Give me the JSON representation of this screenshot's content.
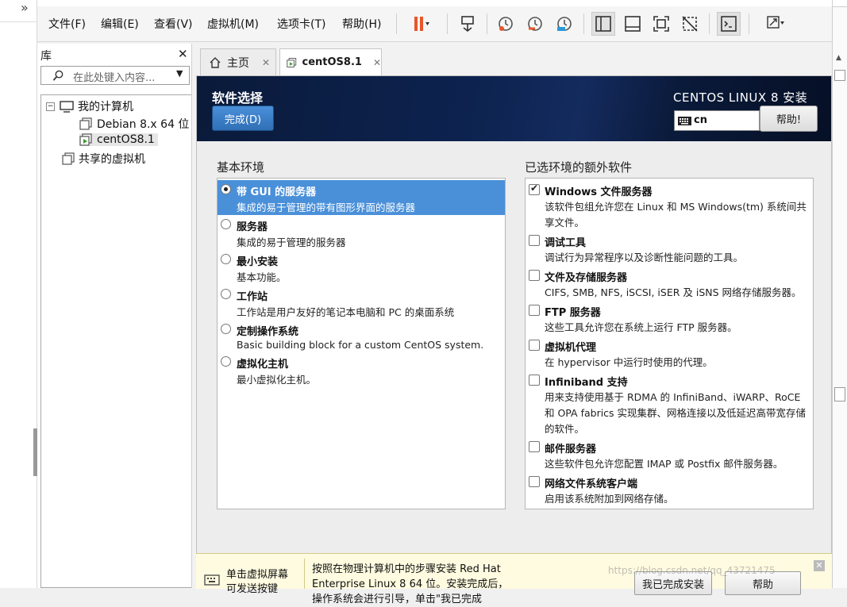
{
  "outer": {
    "chevron": "»"
  },
  "menubar": {
    "items": [
      "文件(F)",
      "编辑(E)",
      "查看(V)",
      "虚拟机(M)",
      "选项卡(T)",
      "帮助(H)"
    ]
  },
  "library": {
    "title": "库",
    "search_placeholder": "在此处键入内容...",
    "tree": {
      "my_computer": "我的计算机",
      "vm1": "Debian 8.x 64 位",
      "vm2": "centOS8.1",
      "shared": "共享的虚拟机"
    }
  },
  "tabs": [
    {
      "label": "主页"
    },
    {
      "label": "centOS8.1"
    }
  ],
  "installer": {
    "title": "软件选择",
    "done_button": "完成(D)",
    "product_title": "CENTOS LINUX 8 安装",
    "keyboard_layout": "cn",
    "help_button": "帮助!",
    "base_env": {
      "title": "基本环境",
      "items": [
        {
          "name": "带 GUI 的服务器",
          "desc": "集成的易于管理的带有图形界面的服务器",
          "selected": true
        },
        {
          "name": "服务器",
          "desc": "集成的易于管理的服务器",
          "selected": false
        },
        {
          "name": "最小安装",
          "desc": "基本功能。",
          "selected": false
        },
        {
          "name": "工作站",
          "desc": "工作站是用户友好的笔记本电脑和 PC 的桌面系统",
          "selected": false
        },
        {
          "name": "定制操作系统",
          "desc": "Basic building block for a custom CentOS system.",
          "selected": false
        },
        {
          "name": "虚拟化主机",
          "desc": "最小虚拟化主机。",
          "selected": false
        }
      ]
    },
    "addons": {
      "title": "已选环境的额外软件",
      "items": [
        {
          "name": "Windows 文件服务器",
          "desc": "该软件包组允许您在 Linux 和 MS Windows(tm) 系统间共享文件。",
          "checked": true
        },
        {
          "name": "调试工具",
          "desc": "调试行为异常程序以及诊断性能问题的工具。",
          "checked": false
        },
        {
          "name": "文件及存储服务器",
          "desc": "CIFS, SMB, NFS, iSCSI, iSER 及 iSNS 网络存储服务器。",
          "checked": false
        },
        {
          "name": "FTP 服务器",
          "desc": "这些工具允许您在系统上运行 FTP 服务器。",
          "checked": false
        },
        {
          "name": "虚拟机代理",
          "desc": "在 hypervisor 中运行时使用的代理。",
          "checked": false
        },
        {
          "name": "Infiniband 支持",
          "desc": "用来支持使用基于 RDMA 的 InfiniBand、iWARP、RoCE 和 OPA fabrics 实现集群、网格连接以及低延迟高带宽存储的软件。",
          "checked": false
        },
        {
          "name": "邮件服务器",
          "desc": "这些软件包允许您配置 IMAP 或 Postfix 邮件服务器。",
          "checked": false
        },
        {
          "name": "网络文件系统客户端",
          "desc": "启用该系统附加到网络存储。",
          "checked": false
        }
      ]
    }
  },
  "bottom_bar": {
    "left_text_1": "单击虚拟屏幕",
    "left_text_2": "可发送按键",
    "mid_text": "按照在物理计算机中的步骤安装 Red Hat Enterprise Linux 8 64 位。安装完成后，操作系统会进行引导，单击\"我已完成",
    "finish_button": "我已完成安装",
    "help_button": "帮助"
  },
  "watermark": "https://blog.csdn.net/qq_43721475"
}
